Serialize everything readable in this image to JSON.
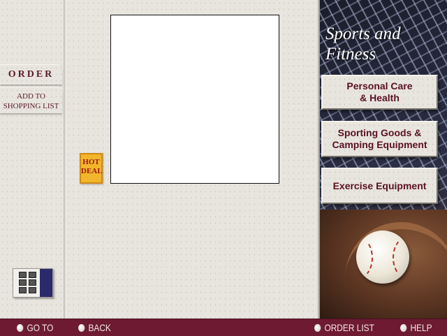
{
  "sidebar": {
    "order_label": "ORDER",
    "shopping_label_line1": "ADD TO",
    "shopping_label_line2": "SHOPPING LIST",
    "calculator_icon": "calculator-icon"
  },
  "main": {
    "hot_deal_line1": "HOT",
    "hot_deal_line2": "DEAL"
  },
  "right": {
    "title_line1": "Sports and",
    "title_line2": "Fitness",
    "categories": [
      {
        "line1": "Personal Care",
        "line2": "& Health"
      },
      {
        "line1": "Sporting Goods &",
        "line2": "Camping Equipment"
      },
      {
        "line1": "Exercise Equipment",
        "line2": ""
      }
    ]
  },
  "nav": {
    "goto": "GO TO",
    "back": "BACK",
    "order_list": "ORDER LIST",
    "help": "HELP"
  },
  "colors": {
    "accent": "#6e1a32",
    "button_text": "#5a1020",
    "hot_deal_bg": "#f1b62b"
  }
}
